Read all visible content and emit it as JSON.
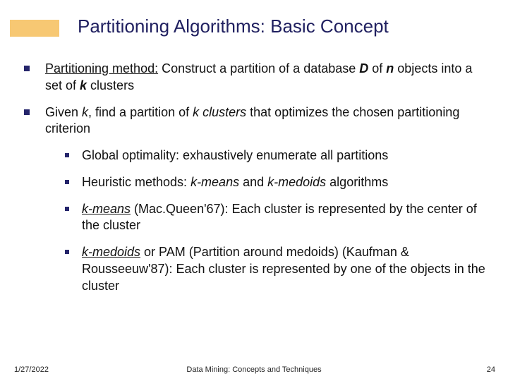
{
  "title": "Partitioning Algorithms: Basic Concept",
  "b1": {
    "pre": "Partitioning method:",
    "a": " Construct a partition of a database ",
    "D": "D",
    "b": " of ",
    "n": "n",
    "c": " objects into a set of ",
    "k": "k",
    "d": " clusters"
  },
  "b2": {
    "a": "Given ",
    "k": "k",
    "b": ", find a partition of ",
    "kc": "k clusters",
    "c": " that optimizes the chosen partitioning criterion"
  },
  "s1": "Global optimality: exhaustively enumerate all partitions",
  "s2": {
    "a": "Heuristic methods: ",
    "km": "k-means",
    "b": " and ",
    "kmed": "k-medoids",
    "c": " algorithms"
  },
  "s3": {
    "km": "k-means",
    "rest": " (Mac.Queen'67): Each cluster is represented by the center of the cluster"
  },
  "s4": {
    "km": "k-medoids",
    "rest": " or PAM (Partition around medoids) (Kaufman & Rousseeuw'87): Each cluster is represented by one of the objects in the cluster"
  },
  "footer": {
    "date": "1/27/2022",
    "center": "Data Mining: Concepts and Techniques",
    "num": "24"
  }
}
